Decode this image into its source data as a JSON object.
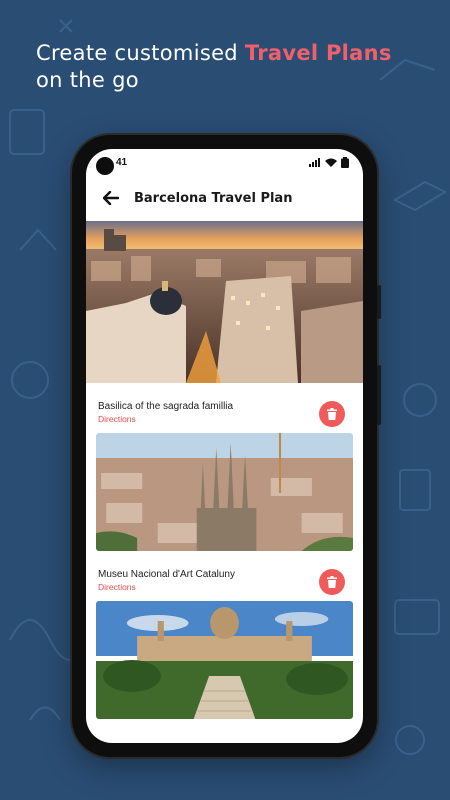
{
  "headline": {
    "line1": "Create customised ",
    "accent": "Travel Plans",
    "line2": "on the go"
  },
  "status_bar": {
    "time": "41"
  },
  "appbar": {
    "title": "Barcelona Travel Plan",
    "back_icon": "arrow-left-icon"
  },
  "plans": [
    {
      "name": "Basilica of the sagrada famillia",
      "link": "Directions",
      "action_icon": "trash-icon"
    },
    {
      "name": "Museu Nacional d'Art Cataluny",
      "link": "Directions",
      "action_icon": "trash-icon"
    }
  ],
  "colors": {
    "background": "#2a4d74",
    "accent": "#f0606a",
    "delete": "#ef5a5a"
  }
}
